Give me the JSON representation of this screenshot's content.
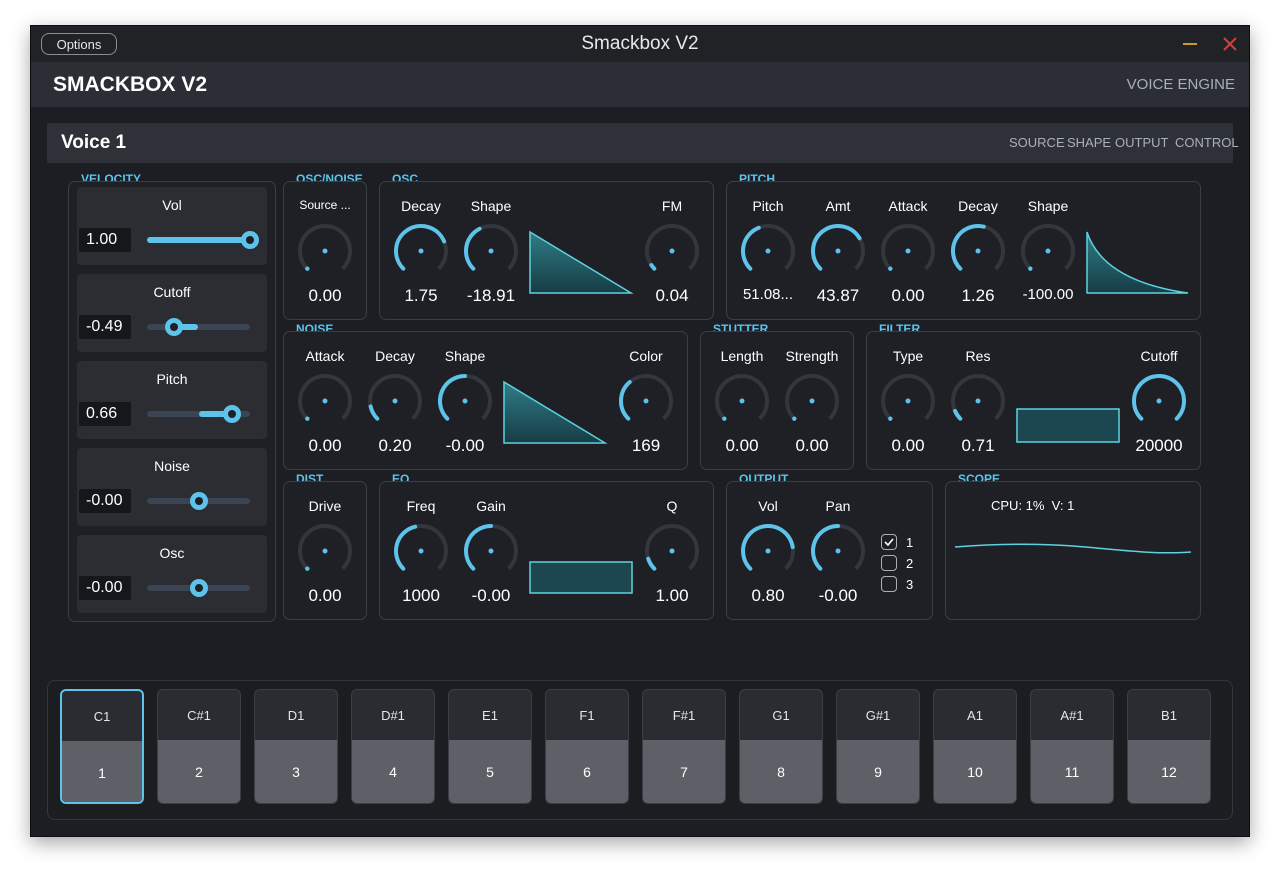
{
  "window": {
    "title": "Smackbox V2",
    "options_label": "Options"
  },
  "header": {
    "app_title": "SMACKBOX V2",
    "engine_label": "VOICE ENGINE"
  },
  "voice": {
    "title": "Voice 1",
    "tabs": [
      "SOURCE",
      "SHAPE",
      "OUTPUT",
      "CONTROL"
    ]
  },
  "colors": {
    "accent": "#5dc3ea",
    "background": "#1c1e23",
    "panel": "#2b2d33"
  },
  "velocity": {
    "title": "VELOCITY",
    "items": [
      {
        "label": "Vol",
        "value": "1.00",
        "level": 1.0
      },
      {
        "label": "Cutoff",
        "value": "-0.49",
        "level": 0.26
      },
      {
        "label": "Pitch",
        "value": "0.66",
        "level": 0.83
      },
      {
        "label": "Noise",
        "value": "-0.00",
        "level": 0.5
      },
      {
        "label": "Osc",
        "value": "-0.00",
        "level": 0.5
      }
    ]
  },
  "osc_noise": {
    "title": "OSC/NOISE",
    "label": "Source ...",
    "value": "0.00",
    "level": 0.0
  },
  "osc": {
    "title": "OSC",
    "knobs": [
      {
        "label": "Decay",
        "value": "1.75",
        "level": 0.75
      },
      {
        "label": "Shape",
        "value": "-18.91",
        "level": 0.4
      },
      {
        "label": "FM",
        "value": "0.04",
        "level": 0.04
      }
    ]
  },
  "pitch": {
    "title": "PITCH",
    "knobs": [
      {
        "label": "Pitch",
        "value": "51.08...",
        "level": 0.42
      },
      {
        "label": "Amt",
        "value": "43.87",
        "level": 0.72
      },
      {
        "label": "Attack",
        "value": "0.00",
        "level": 0.0
      },
      {
        "label": "Decay",
        "value": "1.26",
        "level": 0.55
      },
      {
        "label": "Shape",
        "value": "-100.00",
        "level": 0.0
      }
    ]
  },
  "noise": {
    "title": "NOISE",
    "knobs": [
      {
        "label": "Attack",
        "value": "0.00",
        "level": 0.0
      },
      {
        "label": "Decay",
        "value": "0.20",
        "level": 0.12
      },
      {
        "label": "Shape",
        "value": "-0.00",
        "level": 0.5
      },
      {
        "label": "Color",
        "value": "169",
        "level": 0.35
      }
    ]
  },
  "stutter": {
    "title": "STUTTER",
    "knobs": [
      {
        "label": "Length",
        "value": "0.00",
        "level": 0.0
      },
      {
        "label": "Strength",
        "value": "0.00",
        "level": 0.0
      }
    ]
  },
  "filter": {
    "title": "FILTER",
    "knobs": [
      {
        "label": "Type",
        "value": "0.00",
        "level": 0.0
      },
      {
        "label": "Res",
        "value": "0.71",
        "level": 0.08
      },
      {
        "label": "Cutoff",
        "value": "20000",
        "level": 1.0
      }
    ]
  },
  "dist": {
    "title": "DIST",
    "label": "Drive",
    "value": "0.00",
    "level": 0.0
  },
  "eq": {
    "title": "EQ",
    "knobs": [
      {
        "label": "Freq",
        "value": "1000",
        "level": 0.45
      },
      {
        "label": "Gain",
        "value": "-0.00",
        "level": 0.5
      },
      {
        "label": "Q",
        "value": "1.00",
        "level": 0.1
      }
    ]
  },
  "output": {
    "title": "OUTPUT",
    "knobs": [
      {
        "label": "Vol",
        "value": "0.80",
        "level": 0.8
      },
      {
        "label": "Pan",
        "value": "-0.00",
        "level": 0.5
      }
    ],
    "channels": [
      {
        "label": "1",
        "checked": true
      },
      {
        "label": "2",
        "checked": false
      },
      {
        "label": "3",
        "checked": false
      }
    ]
  },
  "scope": {
    "title": "SCOPE",
    "cpu_text": "CPU: 1%  V: 1"
  },
  "keyboard": {
    "selected": 0,
    "pads": [
      {
        "note": "C1",
        "num": "1"
      },
      {
        "note": "C#1",
        "num": "2"
      },
      {
        "note": "D1",
        "num": "3"
      },
      {
        "note": "D#1",
        "num": "4"
      },
      {
        "note": "E1",
        "num": "5"
      },
      {
        "note": "F1",
        "num": "6"
      },
      {
        "note": "F#1",
        "num": "7"
      },
      {
        "note": "G1",
        "num": "8"
      },
      {
        "note": "G#1",
        "num": "9"
      },
      {
        "note": "A1",
        "num": "10"
      },
      {
        "note": "A#1",
        "num": "11"
      },
      {
        "note": "B1",
        "num": "12"
      }
    ]
  }
}
